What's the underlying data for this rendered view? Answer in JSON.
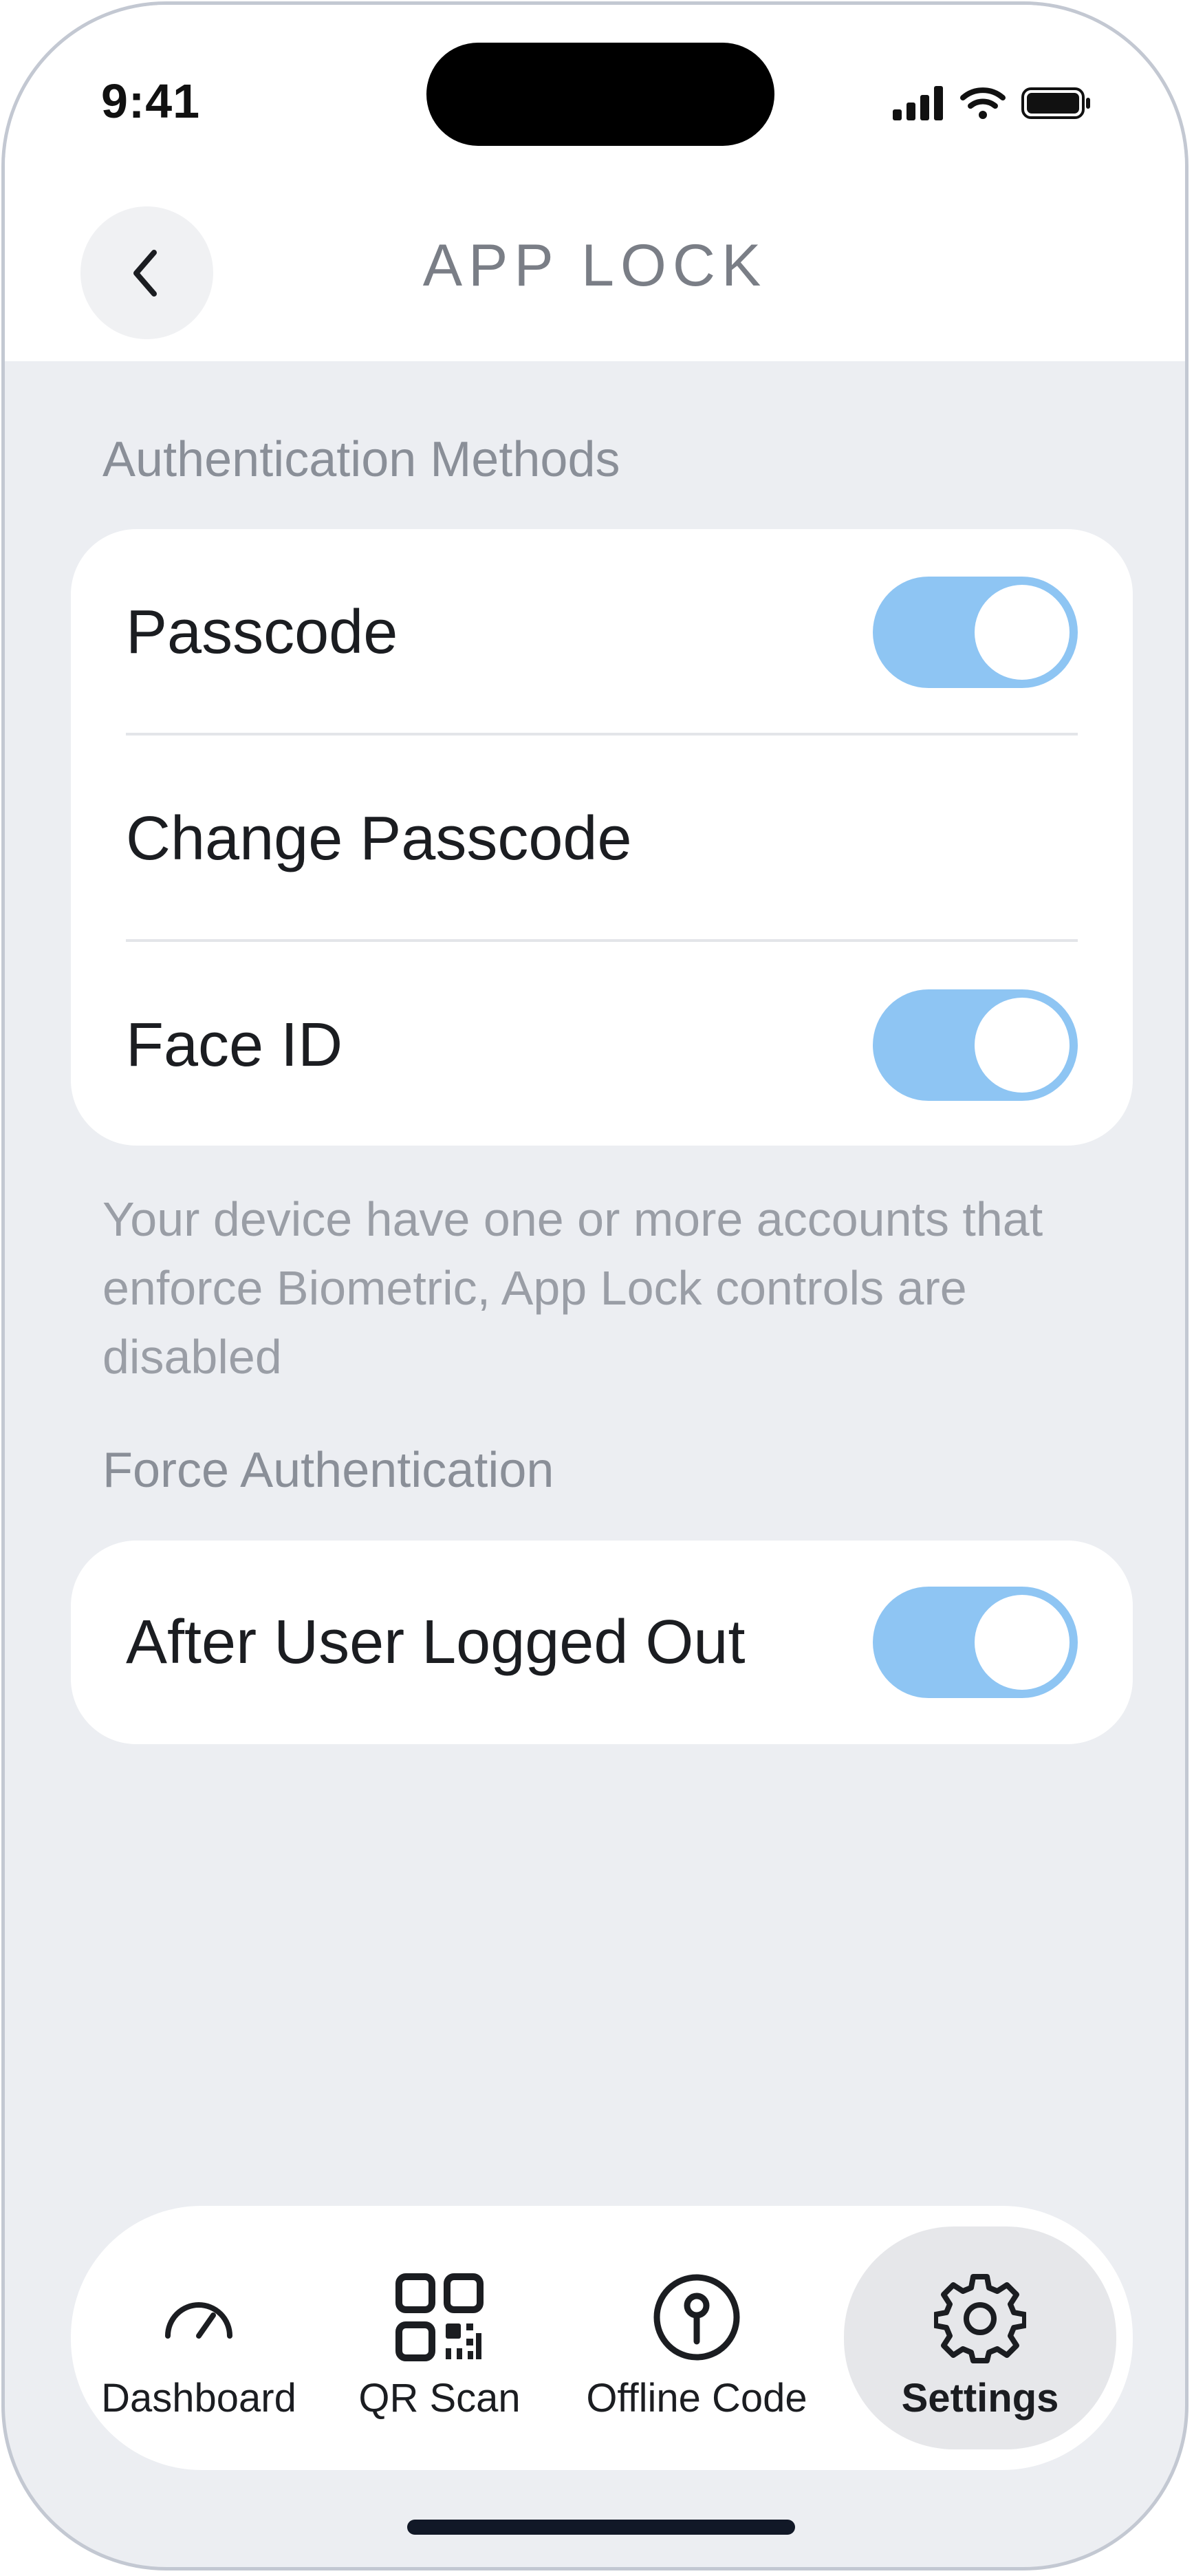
{
  "status_bar": {
    "time": "9:41"
  },
  "header": {
    "title": "APP LOCK",
    "back_icon": "chevron-left-icon"
  },
  "authentication": {
    "section_label": "Authentication Methods",
    "items": [
      {
        "label": "Passcode",
        "toggle": true
      },
      {
        "label": "Change Passcode"
      },
      {
        "label": "Face ID",
        "toggle": true
      }
    ],
    "note": "Your device have one or more accounts that enforce Biometric, App Lock controls are disabled"
  },
  "force_authentication": {
    "section_label": "Force Authentication",
    "items": [
      {
        "label": "After User Logged Out",
        "toggle": true
      }
    ]
  },
  "tab_bar": {
    "tabs": [
      {
        "label": "Dashboard",
        "icon": "gauge-icon"
      },
      {
        "label": "QR Scan",
        "icon": "qr-code-icon"
      },
      {
        "label": "Offline Code",
        "icon": "key-circle-icon"
      },
      {
        "label": "Settings",
        "icon": "gear-icon",
        "active": true
      }
    ]
  },
  "colors": {
    "toggle_on": "#8ec5f3",
    "background": "#eceef2",
    "card": "#ffffff"
  }
}
